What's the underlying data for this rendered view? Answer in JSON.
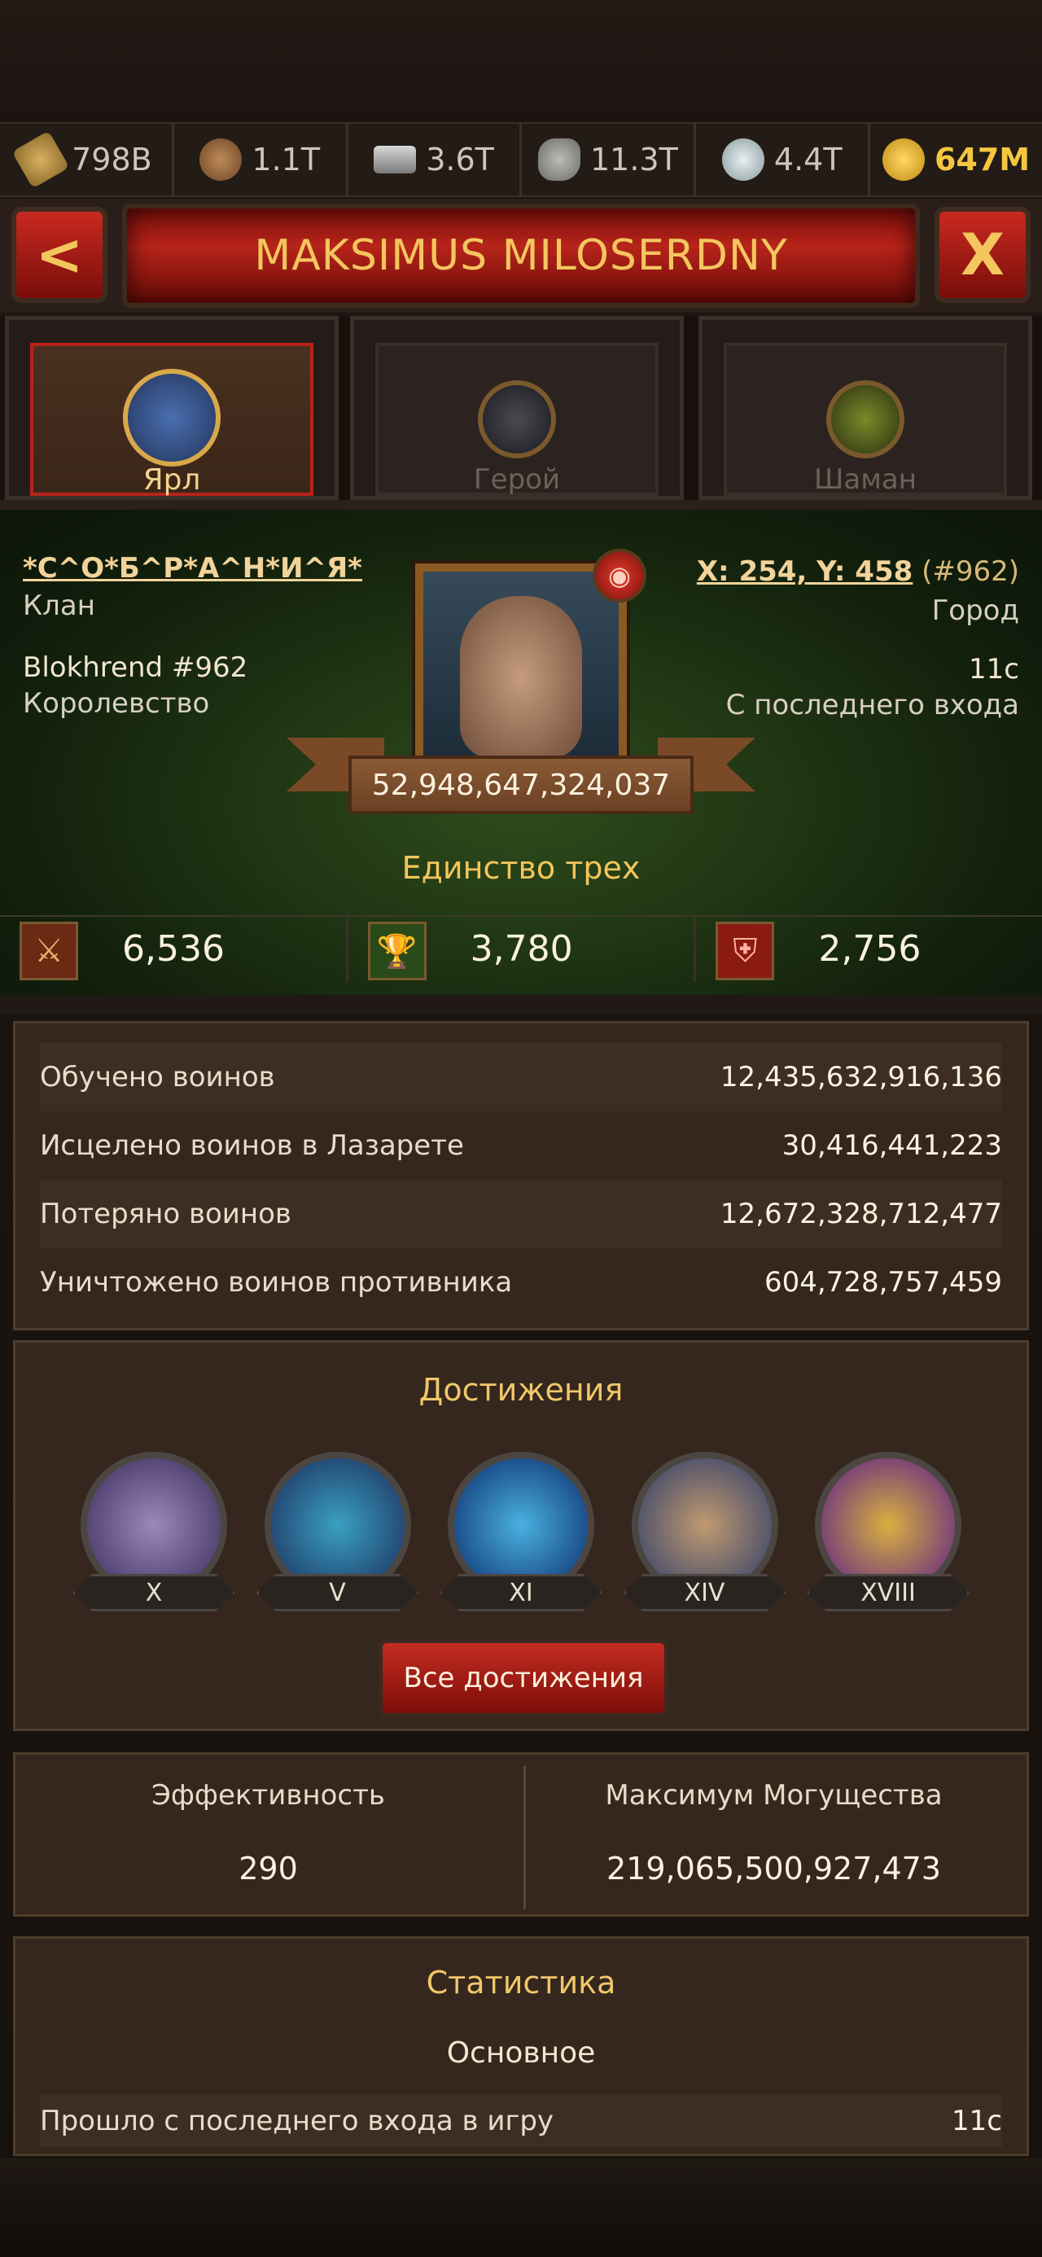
{
  "resources": [
    {
      "icon": "wheat-icon",
      "value": "798B"
    },
    {
      "icon": "wood-icon",
      "value": "1.1T"
    },
    {
      "icon": "iron-icon",
      "value": "3.6T"
    },
    {
      "icon": "stone-icon",
      "value": "11.3T"
    },
    {
      "icon": "silver-icon",
      "value": "4.4T"
    },
    {
      "icon": "gold-icon",
      "value": "647M"
    }
  ],
  "header": {
    "title": "MAKSIMUS MILOSERDNY",
    "back_glyph": "<",
    "close_glyph": "X"
  },
  "tabs": [
    {
      "label": "Ярл"
    },
    {
      "label": "Герой"
    },
    {
      "label": "Шаман"
    }
  ],
  "profile": {
    "clan": "*С^О*Б^Р*А^Н*И^Я*",
    "clan_caption": "Клан",
    "kingdom": "Blokhrend #962",
    "kingdom_caption": "Королевство",
    "coords": "X: 254, Y: 458",
    "coords_num": "(#962)",
    "city_caption": "Город",
    "last_seen": "11с",
    "last_seen_caption": "С последнего входа",
    "power": "52,948,647,324,037",
    "motto": "Единство трех"
  },
  "stats": [
    {
      "icon": "crossed-swords-icon",
      "value": "6,536"
    },
    {
      "icon": "trophy-icon",
      "value": "3,780"
    },
    {
      "icon": "shield-icon",
      "value": "2,756"
    }
  ],
  "troops": [
    {
      "label": "Обучено воинов",
      "value": "12,435,632,916,136"
    },
    {
      "label": "Исцелено воинов в Лазарете",
      "value": "30,416,441,223"
    },
    {
      "label": "Потеряно воинов",
      "value": "12,672,328,712,477"
    },
    {
      "label": "Уничтожено воинов противника",
      "value": "604,728,757,459"
    }
  ],
  "achievements": {
    "title": "Достижения",
    "items": [
      {
        "level": "X"
      },
      {
        "level": "V"
      },
      {
        "level": "XI"
      },
      {
        "level": "XIV"
      },
      {
        "level": "XVIII"
      }
    ],
    "button_label": "Все достижения"
  },
  "efficiency": {
    "label": "Эффективность",
    "value": "290"
  },
  "max_power": {
    "label": "Максимум Могущества",
    "value": "219,065,500,927,473"
  },
  "statistics": {
    "title": "Статистика",
    "section": "Основное",
    "rows": [
      {
        "label": "Прошло с последнего входа в игру",
        "value": "11с"
      }
    ]
  }
}
